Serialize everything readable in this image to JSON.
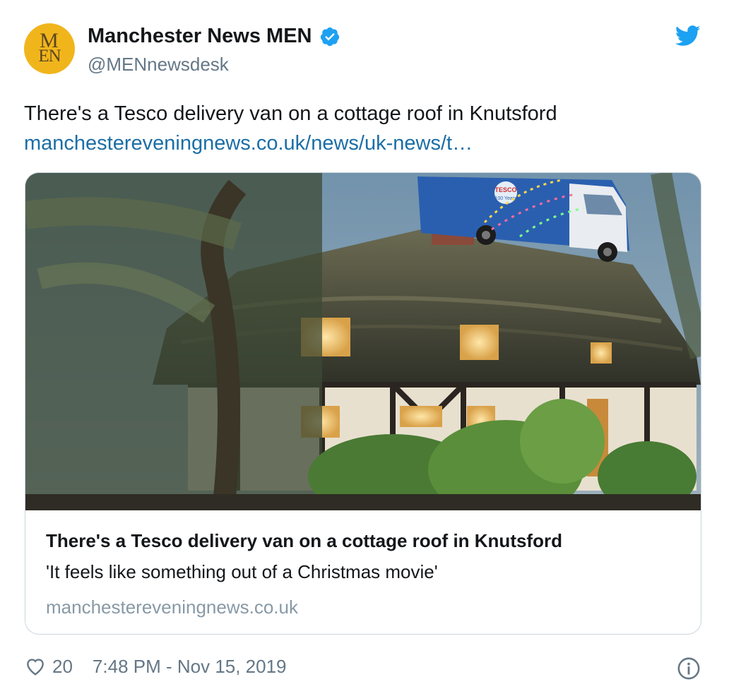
{
  "author": {
    "avatar_line1": "M",
    "avatar_line2": "EN",
    "display_name": "Manchester News MEN",
    "handle": "@MENnewsdesk",
    "verified_icon": "verified-badge-icon"
  },
  "tweet": {
    "text": "There's a Tesco delivery van on a cottage roof in Knutsford",
    "link": "manchestereveningnews.co.uk/news/uk-news/t…"
  },
  "card": {
    "image_description": "photo-thatched-cottage-with-van-on-roof",
    "title": "There's a Tesco delivery van on a cottage roof in Knutsford",
    "description": "'It feels like something out of a Christmas movie'",
    "domain": "manchestereveningnews.co.uk",
    "van_text_top": "TESCO",
    "van_text_bottom": "100 Years"
  },
  "footer": {
    "likes": "20",
    "timestamp": "7:48 PM - Nov 15, 2019"
  },
  "colors": {
    "link": "#1b6ea6",
    "twitter_blue": "#1da1f2",
    "avatar_bg": "#f1b51c",
    "muted": "#657786"
  }
}
